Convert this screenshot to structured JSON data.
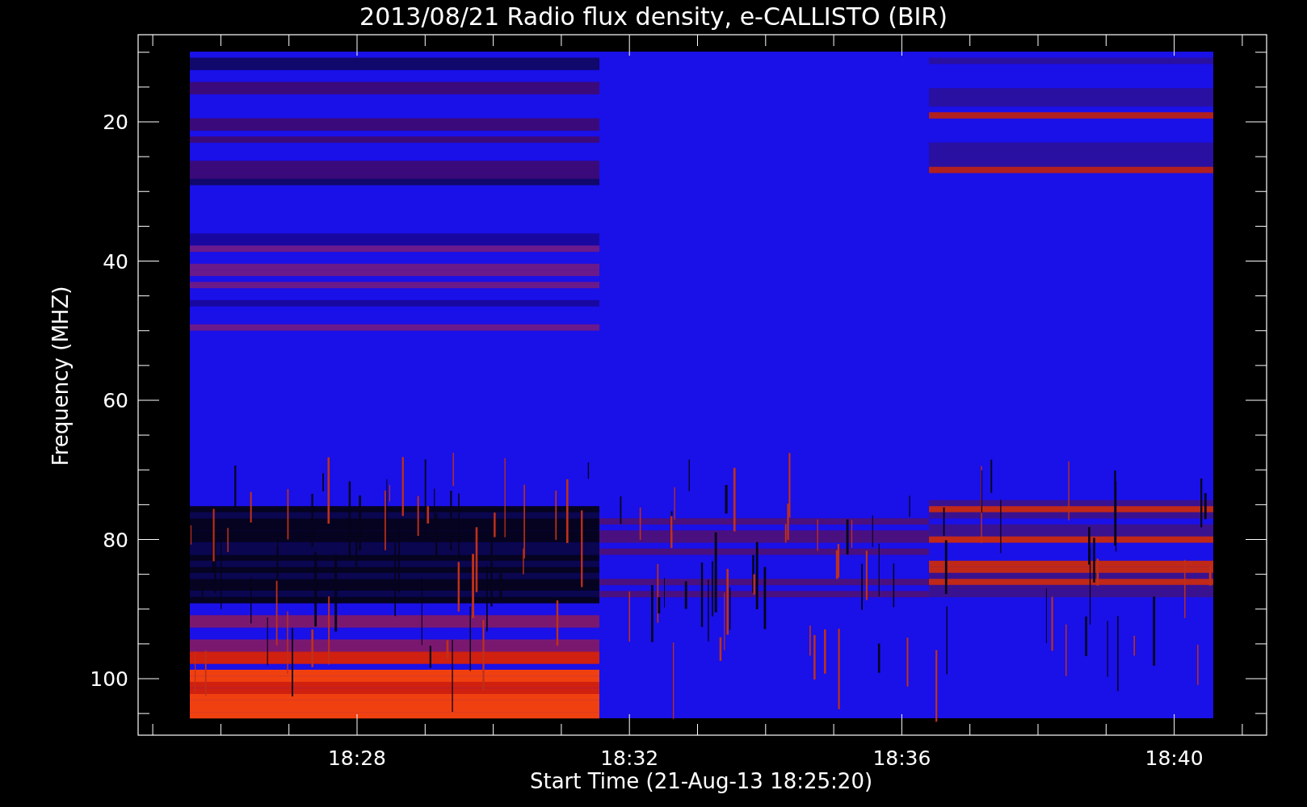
{
  "plot": {
    "title": "2013/08/21  Radio flux density, e-CALLISTO (BIR)",
    "ylabel": "Frequency (MHZ)",
    "xlabel": "Start Time (21-Aug-13 18:25:20)",
    "yticks": [
      "20",
      "40",
      "60",
      "80",
      "100"
    ],
    "xticks": [
      "18:28",
      "18:32",
      "18:36",
      "18:40"
    ]
  }
}
